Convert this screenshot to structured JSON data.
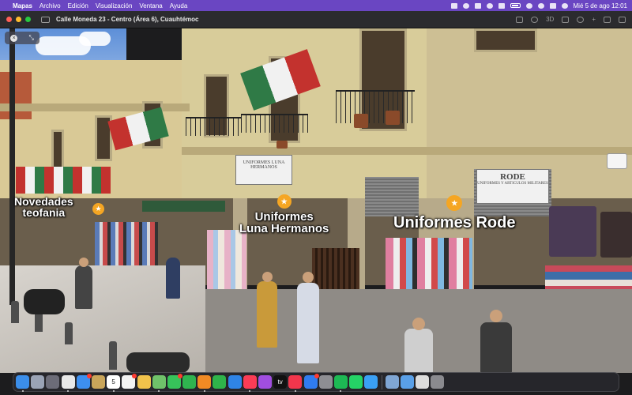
{
  "menubar": {
    "app_name": "Mapas",
    "menus": [
      "Archivo",
      "Edición",
      "Visualización",
      "Ventana",
      "Ayuda"
    ],
    "clock": "Mié 5 de ago  12:01"
  },
  "window": {
    "title": "Calle Moneda 23 - Centro (Área 6), Cuauhtémoc",
    "mode_label": "3D"
  },
  "look_around": {
    "close_label": "×",
    "expand_label": "⤡"
  },
  "pois": [
    {
      "name": "Novedades teofania",
      "line1": "Novedades",
      "line2": "teofania"
    },
    {
      "name": "Uniformes Luna Hermanos",
      "line1": "Uniformes",
      "line2": "Luna Hermanos"
    },
    {
      "name": "Uniformes Rode",
      "line1": "Uniformes Rode",
      "line2": ""
    }
  ],
  "scene_signs": {
    "luna_sign": "UNIFORMES LUNA HERMANOS",
    "rode_sign": "RODE",
    "rode_sub": "UNIFORMES Y ARTICULOS MILITARES"
  },
  "dock": {
    "calendar_day": "5",
    "tv_label": "tv",
    "icons": [
      {
        "name": "finder-icon",
        "color": "#3b8eea"
      },
      {
        "name": "launchpad-icon",
        "color": "#9aa3b5"
      },
      {
        "name": "mission-control-icon",
        "color": "#6c6c78"
      },
      {
        "name": "chrome-icon",
        "color": "#e8e8e8"
      },
      {
        "name": "mail-icon",
        "color": "#3d8ff0"
      },
      {
        "name": "notes-app-icon",
        "color": "#c9a55a"
      },
      {
        "name": "calendar-icon",
        "color": "#ffffff"
      },
      {
        "name": "reminders-icon",
        "color": "#f2f2f2"
      },
      {
        "name": "photos-icon",
        "color": "#f0c24b"
      },
      {
        "name": "maps-icon",
        "color": "#6fc36a"
      },
      {
        "name": "messages-icon",
        "color": "#37c35a"
      },
      {
        "name": "facetime-icon",
        "color": "#2fb34f"
      },
      {
        "name": "pages-icon",
        "color": "#f08a24"
      },
      {
        "name": "numbers-icon",
        "color": "#2fb44a"
      },
      {
        "name": "keynote-icon",
        "color": "#2f84e6"
      },
      {
        "name": "music-icon",
        "color": "#fa3c55"
      },
      {
        "name": "podcasts-icon",
        "color": "#a14ee0"
      },
      {
        "name": "tv-icon",
        "color": "#111111"
      },
      {
        "name": "news-icon",
        "color": "#f1364c"
      },
      {
        "name": "app-store-icon",
        "color": "#2f7cf0"
      },
      {
        "name": "settings-icon",
        "color": "#8e8e93"
      },
      {
        "name": "spotify-icon",
        "color": "#1db954"
      },
      {
        "name": "whatsapp-icon",
        "color": "#25d366"
      },
      {
        "name": "safari-icon",
        "color": "#3aa0f5"
      },
      {
        "name": "preview-icon",
        "color": "#7fa6d4"
      },
      {
        "name": "downloads-folder-icon",
        "color": "#5aa0e8"
      },
      {
        "name": "screenshot-thumb-icon",
        "color": "#dcdcdc"
      },
      {
        "name": "trash-icon",
        "color": "#8a8a8f"
      }
    ]
  }
}
